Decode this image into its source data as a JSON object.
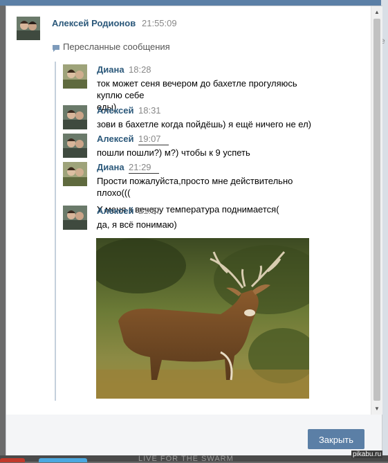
{
  "dialog": {
    "sender": {
      "name": "Алексей Родионов",
      "time": "21:55:09"
    },
    "forwarded_label": "Пересланные сообщения",
    "messages": [
      {
        "author": "Диана",
        "time": "18:28",
        "lines": [
          "ток может сеня вечером до бахетле прогуляюсь куплю себе",
          "еды)"
        ]
      },
      {
        "author": "Алексей",
        "time": "18:31",
        "lines": [
          "зови в бахетле когда пойдёшь) я ещё ничего не ел)"
        ]
      },
      {
        "author": "Алексей",
        "time": "19:07",
        "lines": [
          "пошли пошли?) м?) чтобы к 9 успеть"
        ]
      },
      {
        "author": "Диана",
        "time": "21:29",
        "lines": [
          "Прости пожалуйста,просто мне действительно плохо(((",
          "У меня к вечеру температура поднимается("
        ]
      },
      {
        "author": "Алексей",
        "time": "21:37",
        "lines": [
          "да, я всё понимаю)"
        ]
      }
    ],
    "close_button": "Закрыть"
  },
  "background": {
    "right_marks": [
      "×",
      "ле"
    ],
    "bottom_text": "LIVE FOR THE SWARM",
    "watermark": "pikabu.ru"
  },
  "colors": {
    "accent": "#5b7fa6",
    "name_color": "#2b587a"
  },
  "icons": [
    "forward-message-icon",
    "scroll-up-icon",
    "scroll-down-icon",
    "avatar-couple",
    "deer-photo"
  ]
}
